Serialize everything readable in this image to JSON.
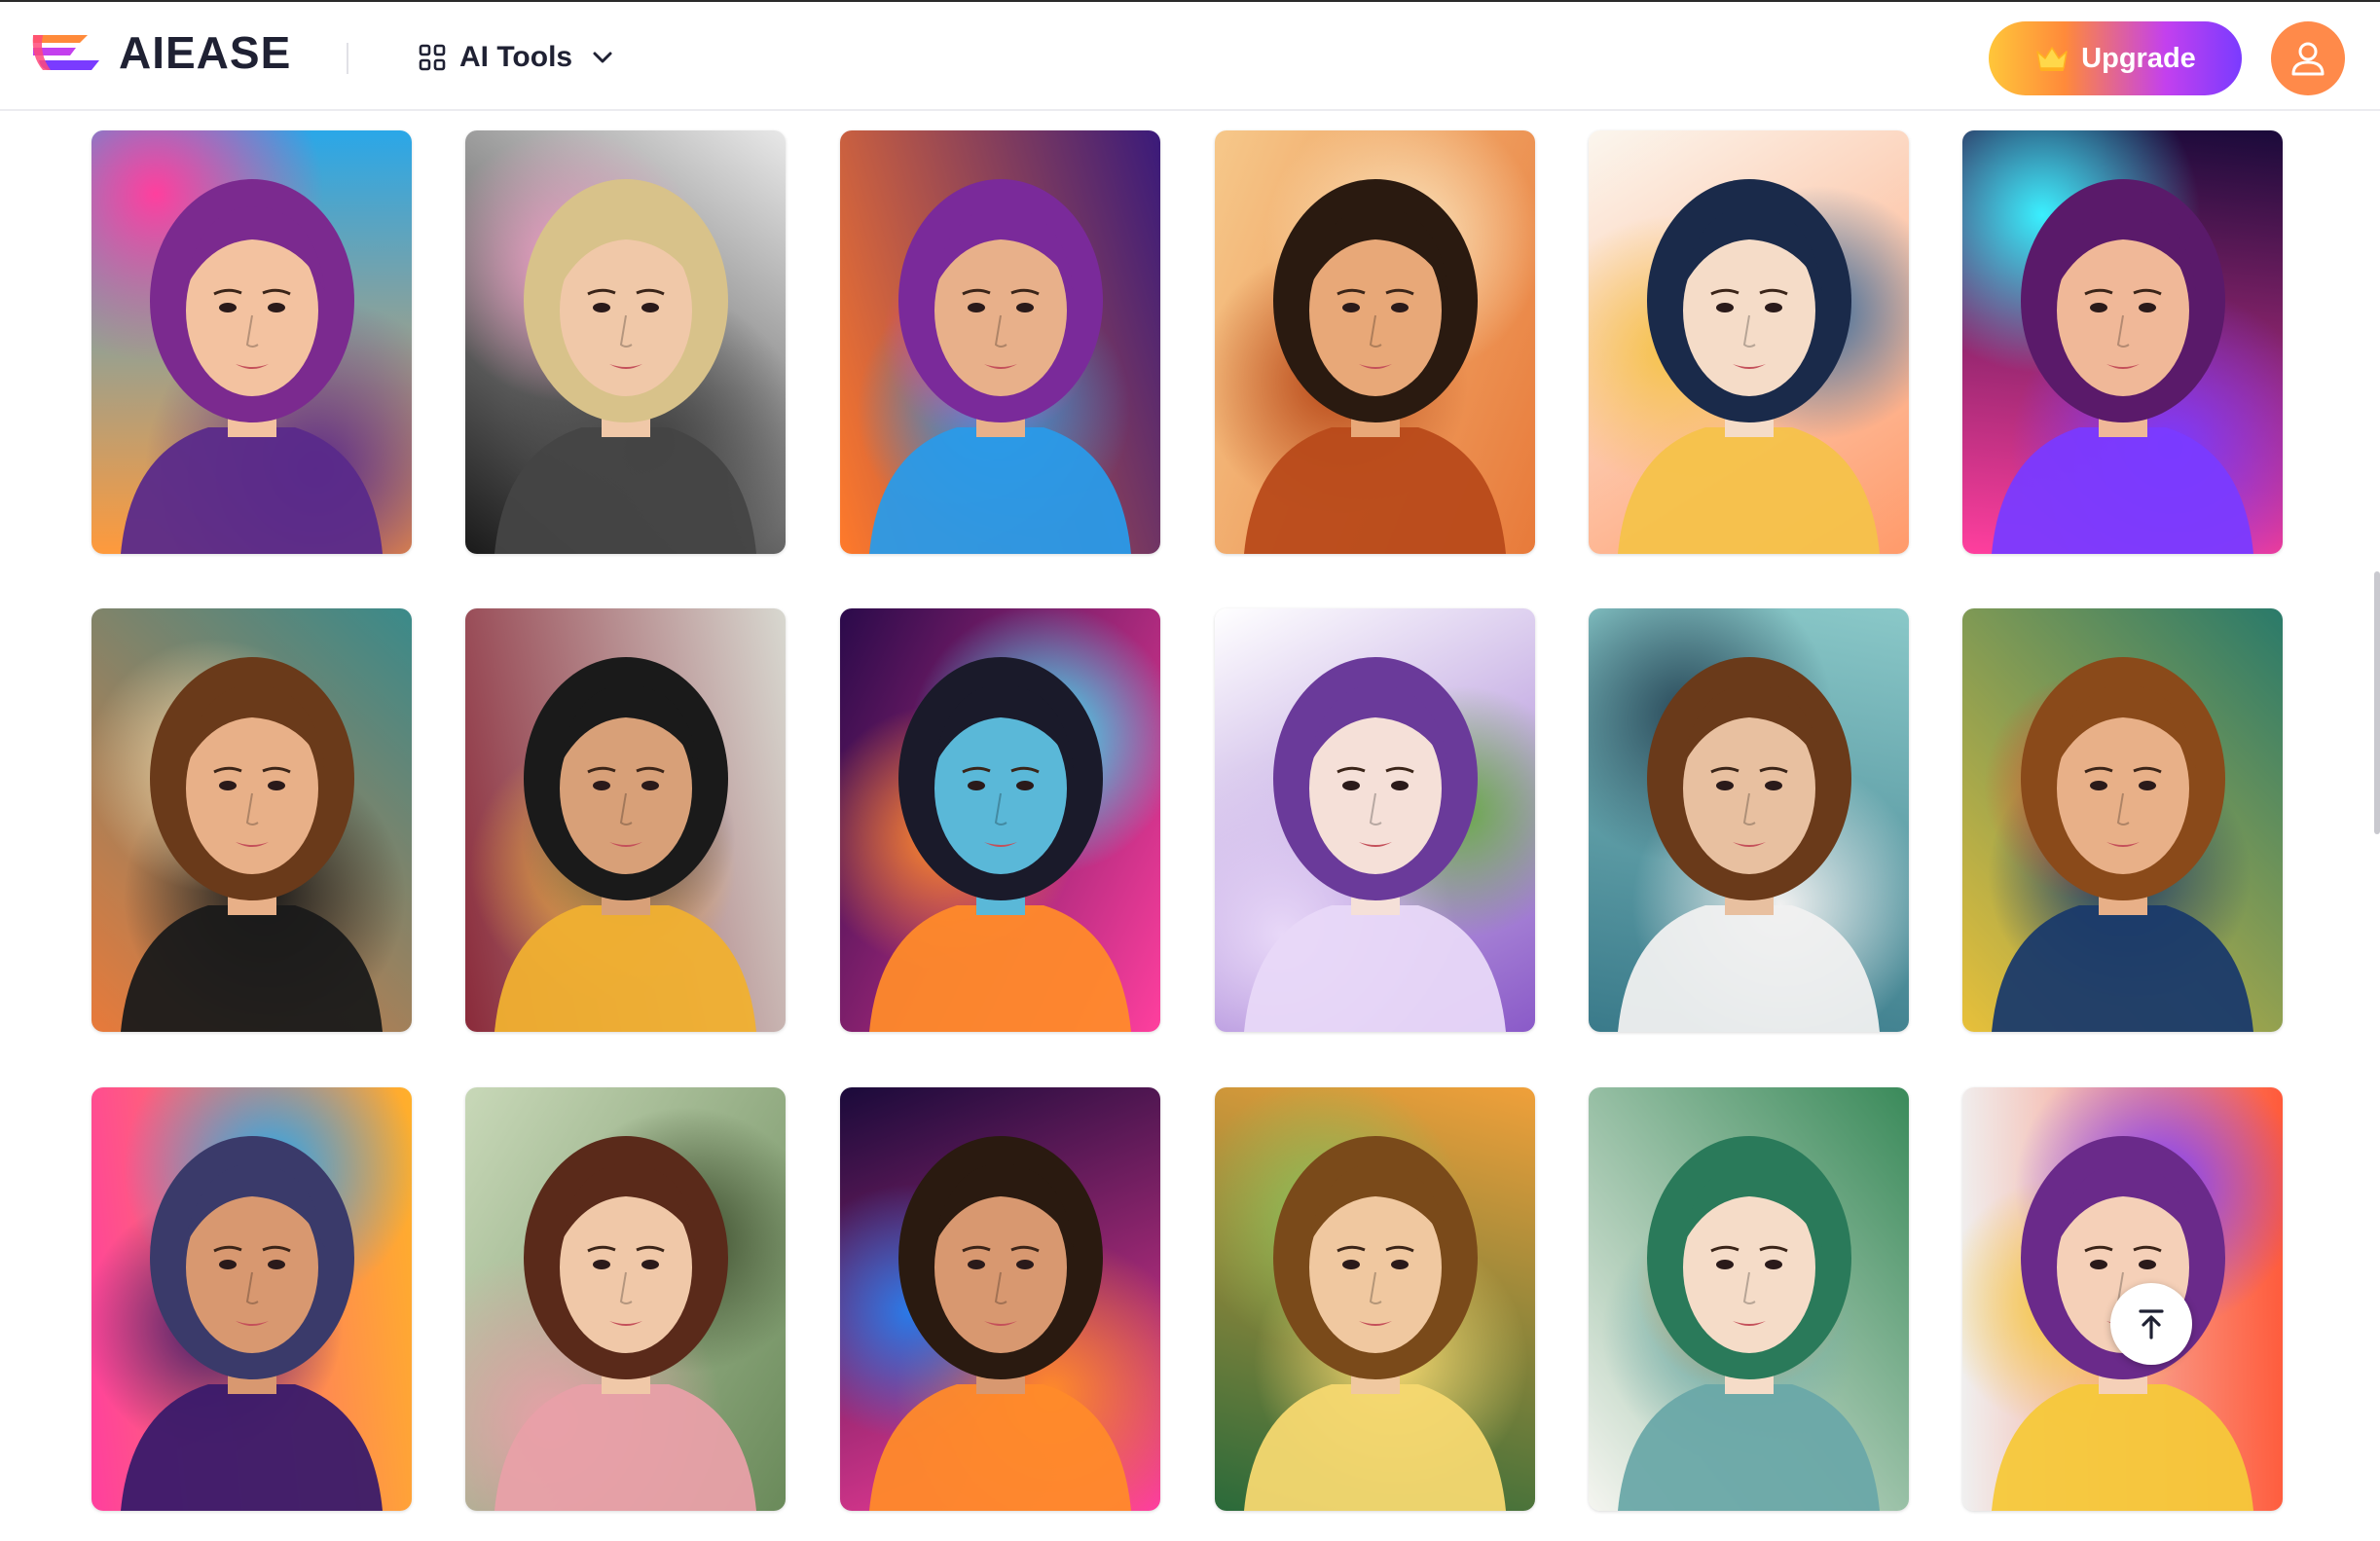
{
  "header": {
    "brand": "AIEASE",
    "tools_label": "AI Tools",
    "upgrade_label": "Upgrade"
  },
  "colors": {
    "upgrade_gradient": [
      "#ffc63a",
      "#ff8a3a",
      "#c340ee",
      "#7a3bff"
    ],
    "avatar_bg": "#ff8a4a",
    "text_dark": "#1f2133"
  },
  "icons": {
    "tools": "grid-icon",
    "tools_toggle": "chevron-down-icon",
    "upgrade": "crown-icon",
    "account": "user-icon",
    "back_to_top": "arrow-up-to-line-icon"
  },
  "gallery": {
    "cards": [
      {
        "id": "style-01",
        "palette": [
          "#ff9a3c",
          "#2aa7e8",
          "#ff3f9e",
          "#5a2a8a"
        ],
        "skin": "#f3c2a0",
        "hair": "#7b2a8f"
      },
      {
        "id": "style-02",
        "palette": [
          "#1a1a1a",
          "#e8e8e8",
          "#f5a0c8",
          "#444444"
        ],
        "skin": "#f0c8a8",
        "hair": "#d8c28a"
      },
      {
        "id": "style-03",
        "palette": [
          "#ff7a2a",
          "#3a1a7a",
          "#ff3f9e",
          "#2a9ae8"
        ],
        "skin": "#e8b08a",
        "hair": "#7a2a9a"
      },
      {
        "id": "style-04",
        "palette": [
          "#f6c88a",
          "#e87a3a",
          "#fbe6c0",
          "#b84a1a"
        ],
        "skin": "#e8a878",
        "hair": "#2a1a10"
      },
      {
        "id": "style-05",
        "palette": [
          "#fbf6ee",
          "#ff9a6a",
          "#3a6a9a",
          "#f5c24a"
        ],
        "skin": "#f5dcc8",
        "hair": "#1a2a4a"
      },
      {
        "id": "style-06",
        "palette": [
          "#ff3f9e",
          "#1a0a3a",
          "#3af0ff",
          "#7a3aff"
        ],
        "skin": "#f0b898",
        "hair": "#5a1a6a"
      },
      {
        "id": "style-07",
        "palette": [
          "#e87a3a",
          "#3a8a8a",
          "#f6d8a8",
          "#1a1a1a"
        ],
        "skin": "#e8b088",
        "hair": "#6a3a1a"
      },
      {
        "id": "style-08",
        "palette": [
          "#8a2a3a",
          "#d8d8d0",
          "#3a3a5a",
          "#f0b030"
        ],
        "skin": "#d8a078",
        "hair": "#1a1a1a"
      },
      {
        "id": "style-09",
        "palette": [
          "#2a0a4a",
          "#ff3f9e",
          "#3af0ff",
          "#ff8a2a"
        ],
        "skin": "#5ab8d8",
        "hair": "#1a1a2a"
      },
      {
        "id": "style-10",
        "palette": [
          "#ffffff",
          "#8a5ac8",
          "#6aa84a",
          "#e8d8f8"
        ],
        "skin": "#f5e0d8",
        "hair": "#6a3a9a"
      },
      {
        "id": "style-11",
        "palette": [
          "#3a7a8a",
          "#8ac8c8",
          "#2a4a5a",
          "#f0f0f0"
        ],
        "skin": "#e8c0a0",
        "hair": "#6a3a1a"
      },
      {
        "id": "style-12",
        "palette": [
          "#e8c03a",
          "#2a7a6a",
          "#e83a2a",
          "#1a3a6a"
        ],
        "skin": "#e8b088",
        "hair": "#8a4a1a"
      },
      {
        "id": "style-13",
        "palette": [
          "#ff3f9e",
          "#ffb02a",
          "#2aa7e8",
          "#3a1a6a"
        ],
        "skin": "#d89870",
        "hair": "#3a3a6a"
      },
      {
        "id": "style-14",
        "palette": [
          "#c8d8b8",
          "#6a8a5a",
          "#3a4a2a",
          "#e8a0a8"
        ],
        "skin": "#f0c8a8",
        "hair": "#5a2a1a"
      },
      {
        "id": "style-15",
        "palette": [
          "#1a0a3a",
          "#ff3f9e",
          "#2a7ae8",
          "#ff8a2a"
        ],
        "skin": "#d89870",
        "hair": "#2a1a10"
      },
      {
        "id": "style-16",
        "palette": [
          "#2a6a3a",
          "#f0a03a",
          "#8ac05a",
          "#f5d870"
        ],
        "skin": "#f0c8a0",
        "hair": "#7a4a1a"
      },
      {
        "id": "style-17",
        "palette": [
          "#f5f5f0",
          "#3a8a5a",
          "#f0a050",
          "#6aa8a8"
        ],
        "skin": "#f5dcc8",
        "hair": "#2a7a5a"
      },
      {
        "id": "style-18",
        "palette": [
          "#f0f0f0",
          "#ff5a3a",
          "#7a3aff",
          "#f5c83a"
        ],
        "skin": "#f5d0b8",
        "hair": "#6a2a8a"
      }
    ]
  }
}
